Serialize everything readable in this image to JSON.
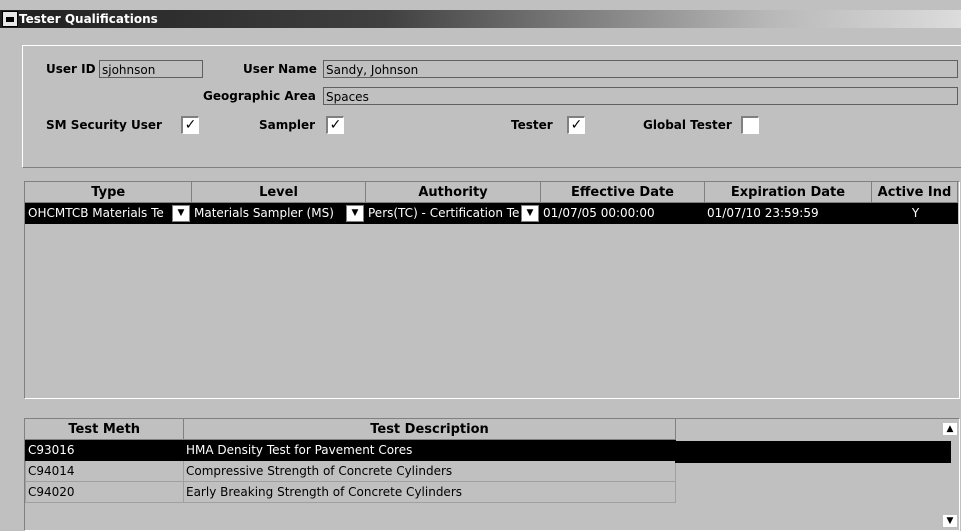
{
  "window": {
    "title": "Tester Qualifications"
  },
  "user": {
    "user_id_label": "User ID",
    "user_id_value": "sjohnson",
    "user_name_label": "User Name",
    "user_name_value": "Sandy, Johnson",
    "geo_area_label": "Geographic Area",
    "geo_area_value": "Spaces",
    "sm_security_label": "SM Security User",
    "sm_security_checked": true,
    "sampler_label": "Sampler",
    "sampler_checked": true,
    "tester_label": "Tester",
    "tester_checked": true,
    "global_tester_label": "Global Tester",
    "global_tester_checked": false
  },
  "qualifications": {
    "columns": [
      "Type",
      "Level",
      "Authority",
      "Effective Date",
      "Expiration Date",
      "Active Ind"
    ],
    "rows": [
      {
        "type": "OHCMTCB Materials Te",
        "level": "Materials Sampler (MS)",
        "authority": "Pers(TC) - Certification Te",
        "effective": "01/07/05 00:00:00",
        "expiration": "01/07/10 23:59:59",
        "active": "Y"
      }
    ]
  },
  "tests": {
    "columns": [
      "Test Meth",
      "Test Description"
    ],
    "rows": [
      {
        "method": "C93016",
        "description": "HMA Density Test for Pavement Cores"
      },
      {
        "method": "C94014",
        "description": "Compressive Strength of Concrete Cylinders"
      },
      {
        "method": "C94020",
        "description": "Early Breaking Strength of Concrete Cylinders"
      }
    ]
  }
}
